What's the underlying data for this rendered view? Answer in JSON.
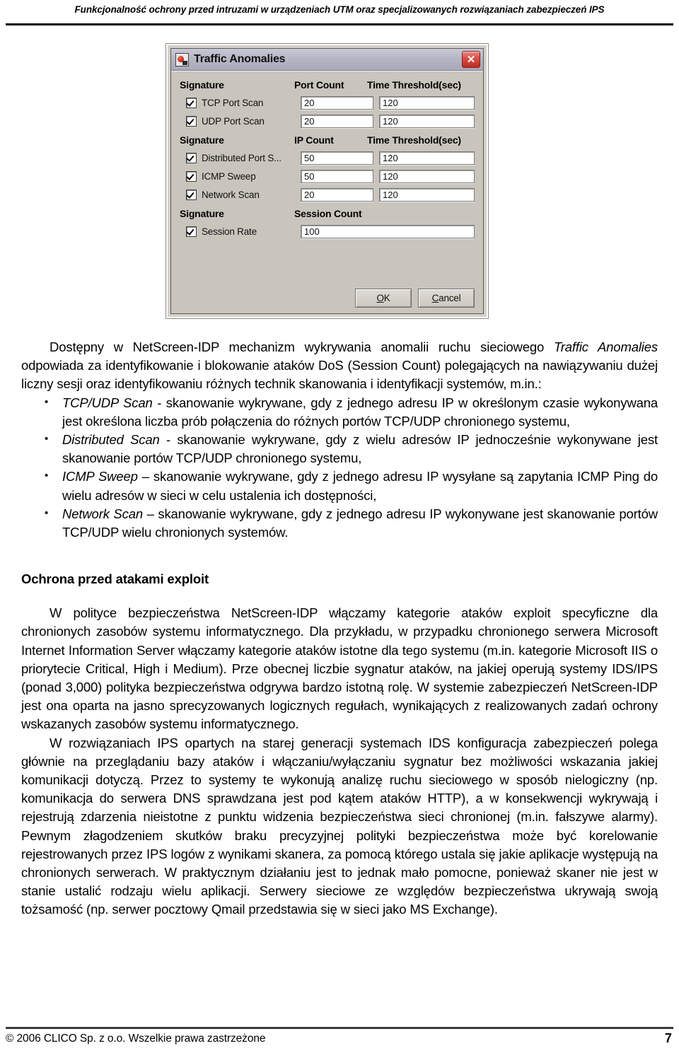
{
  "header": {
    "running_title": "Funkcjonalność ochrony przed intruzami w urządzeniach UTM oraz specjalizowanych rozwiązaniach zabezpieczeń IPS"
  },
  "figure": {
    "dialog": {
      "title": "Traffic Anomalies",
      "title_icon": "app-icon",
      "close_glyph": "✕",
      "groups": [
        {
          "headers": [
            "Signature",
            "Port Count",
            "Time Threshold(sec)"
          ],
          "rows": [
            {
              "label": "TCP Port Scan",
              "checked": true,
              "count": "20",
              "threshold": "120"
            },
            {
              "label": "UDP Port Scan",
              "checked": true,
              "count": "20",
              "threshold": "120"
            }
          ]
        },
        {
          "headers": [
            "Signature",
            "IP Count",
            "Time Threshold(sec)"
          ],
          "rows": [
            {
              "label": "Distributed Port S...",
              "checked": true,
              "count": "50",
              "threshold": "120"
            },
            {
              "label": "ICMP Sweep",
              "checked": true,
              "count": "50",
              "threshold": "120"
            },
            {
              "label": "Network Scan",
              "checked": true,
              "count": "20",
              "threshold": "120"
            }
          ]
        },
        {
          "headers": [
            "Signature",
            "Session Count",
            ""
          ],
          "rows": [
            {
              "label": "Session Rate",
              "checked": true,
              "count": "100",
              "threshold": ""
            }
          ]
        }
      ],
      "buttons": {
        "ok": "OK",
        "cancel": "Cancel"
      }
    }
  },
  "body": {
    "intro": "Dostępny w NetScreen-IDP mechanizm wykrywania anomalii ruchu sieciowego Traffic Anomalies odpowiada za identyfikowanie i blokowanie ataków DoS (Session Count) polegających na nawiązywaniu dużej liczny sesji oraz identyfikowaniu różnych technik skanowania i identyfikacji systemów, m.in.:",
    "intro_parts": {
      "p1": "Dostępny w NetScreen-IDP mechanizm wykrywania anomalii ruchu sieciowego ",
      "em": "Traffic Anomalies",
      "p2": " odpowiada za identyfikowanie i blokowanie ataków DoS (Session Count) polegających na nawiązywaniu dużej liczny sesji oraz identyfikowaniu różnych technik skanowania i identyfikacji systemów, m.in.:"
    },
    "bullets": [
      {
        "term": "TCP/UDP Scan",
        "text": " - skanowanie wykrywane, gdy z jednego adresu IP w określonym czasie wykonywana jest określona liczba prób połączenia do różnych portów TCP/UDP chronionego systemu,"
      },
      {
        "term": "Distributed Scan",
        "text": " - skanowanie wykrywane, gdy z wielu adresów IP jednocześnie wykonywane jest skanowanie portów TCP/UDP chronionego systemu,"
      },
      {
        "term": "ICMP Sweep",
        "text": " – skanowanie wykrywane, gdy z jednego adresu IP wysyłane są zapytania ICMP Ping do wielu adresów w sieci w celu ustalenia ich dostępności,"
      },
      {
        "term": "Network Scan",
        "text": " – skanowanie wykrywane, gdy z jednego adresu IP wykonywane jest skanowanie portów TCP/UDP wielu chronionych systemów."
      }
    ],
    "section_heading": "Ochrona przed atakami exploit",
    "para_1": "W polityce bezpieczeństwa NetScreen-IDP włączamy kategorie ataków exploit specyficzne dla chronionych zasobów systemu informatycznego. Dla przykładu, w przypadku chronionego serwera Microsoft Internet Information Server włączamy kategorie ataków istotne dla tego systemu (m.in. kategorie Microsoft IIS o priorytecie Critical, High i Medium). Prze obecnej liczbie sygnatur ataków, na jakiej operują systemy IDS/IPS (ponad 3,000) polityka bezpieczeństwa odgrywa bardzo istotną rolę. W systemie zabezpieczeń NetScreen-IDP jest ona oparta na jasno sprecyzowanych logicznych regułach, wynikających z realizowanych zadań ochrony wskazanych zasobów systemu informatycznego.",
    "para_2": "W rozwiązaniach IPS opartych na starej generacji systemach IDS konfiguracja zabezpieczeń polega głównie na przeglądaniu bazy ataków i włączaniu/wyłączaniu sygnatur bez możliwości wskazania jakiej komunikacji dotyczą. Przez to systemy te wykonują analizę ruchu sieciowego w sposób nielogiczny (np. komunikacja do serwera DNS sprawdzana jest pod kątem ataków HTTP), a w konsekwencji wykrywają i rejestrują zdarzenia nieistotne z punktu widzenia bezpieczeństwa sieci chronionej (m.in. fałszywe alarmy). Pewnym złagodzeniem skutków braku precyzyjnej polityki bezpieczeństwa może być korelowanie rejestrowanych przez IPS logów z wynikami skanera, za pomocą którego ustala się jakie aplikacje występują na chronionych serwerach. W praktycznym działaniu jest to jednak mało pomocne, ponieważ skaner nie jest w stanie ustalić rodzaju wielu aplikacji. Serwery sieciowe ze względów bezpieczeństwa ukrywają swoją tożsamość (np. serwer pocztowy Qmail przedstawia się w sieci jako MS Exchange)."
  },
  "footer": {
    "copyright": "© 2006 CLICO Sp. z o.o. Wszelkie prawa zastrzeżone",
    "page_number": "7"
  }
}
